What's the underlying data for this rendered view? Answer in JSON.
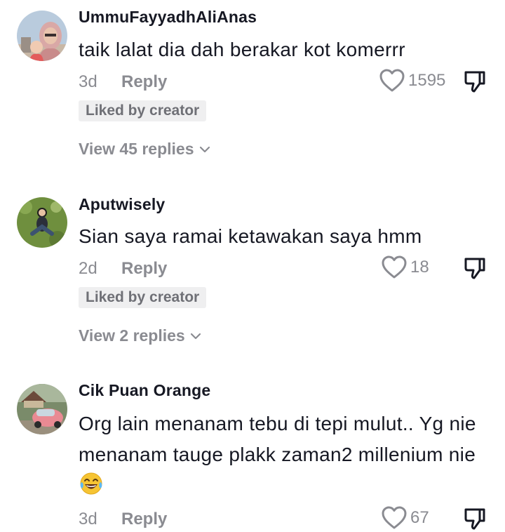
{
  "colors": {
    "text_primary": "#161823",
    "text_secondary": "#8a8b91",
    "badge_bg": "#efeff0"
  },
  "comments": [
    {
      "username": "UmmuFayyadhAliAnas",
      "text": "taik lalat dia dah berakar kot komerrr",
      "age": "3d",
      "reply_label": "Reply",
      "like_count": "1595",
      "badge": "Liked by creator",
      "view_replies": "View 45 replies",
      "avatar": "avatar-woman-hijab-with-child"
    },
    {
      "username": "Aputwisely",
      "text": "Sian saya ramai ketawakan saya hmm",
      "age": "2d",
      "reply_label": "Reply",
      "like_count": "18",
      "badge": "Liked by creator",
      "view_replies": "View 2 replies",
      "avatar": "avatar-person-on-grass"
    },
    {
      "username": "Cik Puan Orange",
      "text": "Org lain menanam tebu di tepi mulut.. Yg nie menanam tauge plakk zaman2 millenium nie",
      "emoji": "laughing-tears-emoji",
      "age": "3d",
      "reply_label": "Reply",
      "like_count": "67",
      "avatar": "avatar-pink-car"
    }
  ]
}
